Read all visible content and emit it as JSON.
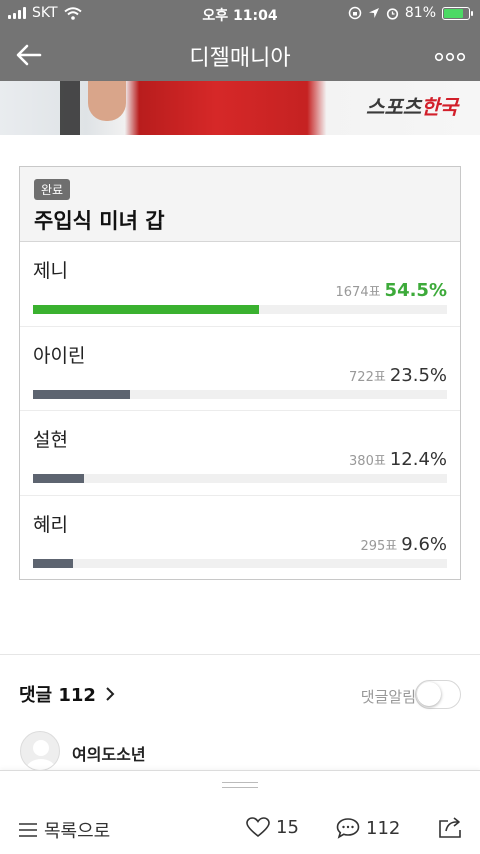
{
  "status_bar": {
    "carrier": "SKT",
    "time": "오후 11:04",
    "battery": "81%",
    "battery_level": 0.81
  },
  "nav": {
    "title": "디젤매니아",
    "back_icon": "back-arrow-icon",
    "more_icon": "more-dots-icon"
  },
  "banner": {
    "logo_a": "스포츠",
    "logo_b": "한국"
  },
  "poll": {
    "badge": "완료",
    "title": "주입식 미녀 갑",
    "options": [
      {
        "name": "제니",
        "votes": "1674표",
        "percent": "54.5%",
        "ratio": 0.545,
        "winner": true
      },
      {
        "name": "아이린",
        "votes": "722표",
        "percent": "23.5%",
        "ratio": 0.235,
        "winner": false
      },
      {
        "name": "설현",
        "votes": "380표",
        "percent": "12.4%",
        "ratio": 0.124,
        "winner": false
      },
      {
        "name": "혜리",
        "votes": "295표",
        "percent": "9.6%",
        "ratio": 0.096,
        "winner": false
      }
    ]
  },
  "comments": {
    "header": "댓글 112",
    "alarm_label": "댓글알림",
    "alarm_on": false,
    "first_user": "여의도소년"
  },
  "bottom": {
    "list_label": "목록으로",
    "likes": "15",
    "comments": "112"
  },
  "colors": {
    "bar_bg": "#747474",
    "winner": "#3ab12f",
    "bar": "#5d6470"
  }
}
